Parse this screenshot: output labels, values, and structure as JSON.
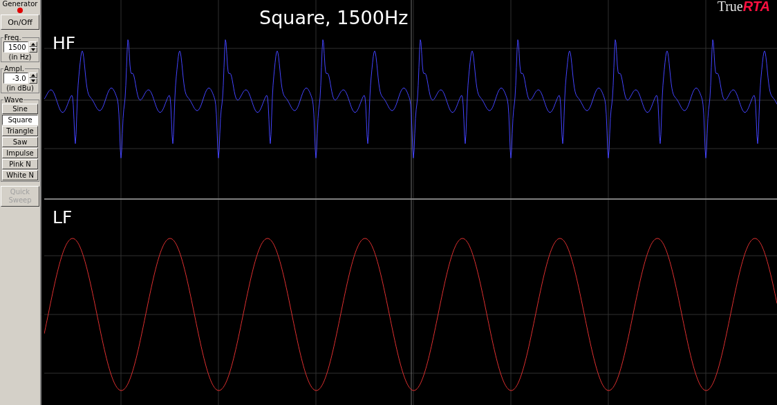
{
  "generator": {
    "title": "Generator",
    "led_on": true,
    "power_button": "On/Off",
    "freq": {
      "label": "Freq.",
      "value": "1500",
      "unit": "(in Hz)"
    },
    "ampl": {
      "label": "Ampl.",
      "value": "-3.0",
      "unit": "(in dBu)"
    },
    "wave": {
      "label": "Wave",
      "buttons": [
        {
          "label": "Sine",
          "selected": false
        },
        {
          "label": "Square",
          "selected": true
        },
        {
          "label": "Triangle",
          "selected": false
        },
        {
          "label": "Saw",
          "selected": false
        },
        {
          "label": "Impulse",
          "selected": false
        },
        {
          "label": "Pink N",
          "selected": false
        },
        {
          "label": "White N",
          "selected": false
        }
      ]
    },
    "sweep_button": {
      "label": "Quick Sweep",
      "disabled": true
    }
  },
  "scope": {
    "title": "Square, 1500Hz",
    "logo": {
      "first": "True",
      "second": "RTA"
    },
    "channels": [
      {
        "label": "HF",
        "color": "#4444ff",
        "kind": "spiky"
      },
      {
        "label": "LF",
        "color": "#e03030",
        "kind": "sine"
      }
    ]
  }
}
